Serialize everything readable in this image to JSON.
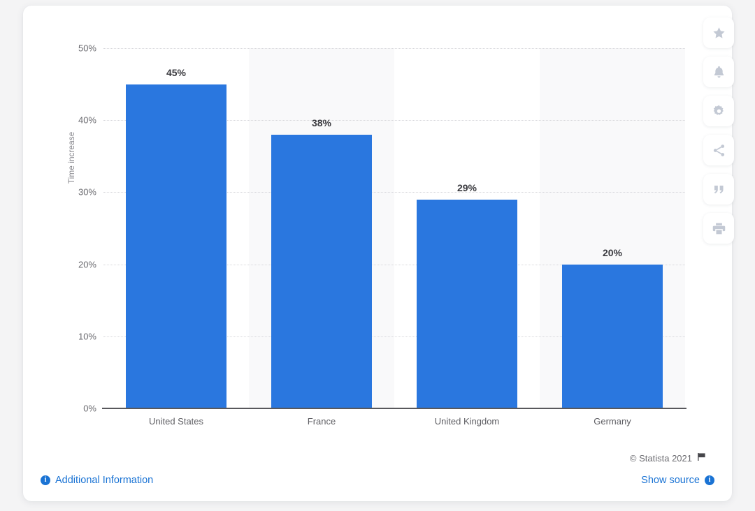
{
  "chart_data": {
    "type": "bar",
    "title": "",
    "subtitle": "",
    "xlabel": "",
    "ylabel": "Time increase",
    "categories": [
      "United States",
      "France",
      "United Kingdom",
      "Germany"
    ],
    "values": [
      45,
      38,
      29,
      20
    ],
    "value_labels": [
      "45%",
      "38%",
      "29%",
      "20%"
    ],
    "ytick_labels": [
      "50%",
      "40%",
      "30%",
      "20%",
      "10%",
      "0%"
    ],
    "ytick_values": [
      50,
      40,
      30,
      20,
      10,
      0
    ],
    "ylim": [
      0,
      50
    ],
    "unit": "%",
    "grid": true,
    "legend": false,
    "bar_color": "#2a77df",
    "band_color": "#f9f9fa"
  },
  "footer": {
    "copyright": "© Statista 2021",
    "flag_icon": "flag-icon",
    "additional_information": "Additional Information",
    "show_source": "Show source",
    "link_color": "#1a73d4"
  },
  "toolbar": {
    "items": [
      {
        "name": "favorite-button",
        "icon": "star-icon"
      },
      {
        "name": "alert-button",
        "icon": "bell-icon"
      },
      {
        "name": "settings-button",
        "icon": "gear-icon"
      },
      {
        "name": "share-button",
        "icon": "share-icon"
      },
      {
        "name": "cite-button",
        "icon": "quote-icon"
      },
      {
        "name": "print-button",
        "icon": "printer-icon"
      }
    ],
    "icon_color": "#c3c9d4"
  }
}
